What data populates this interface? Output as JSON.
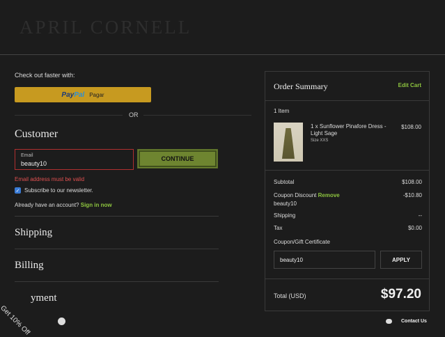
{
  "header": {
    "logo": "APRIL CORNELL"
  },
  "checkout": {
    "fast_label": "Check out faster with:",
    "paypal_pay": "Pay",
    "paypal_pal": "Pal",
    "paypal_action": "Pagar",
    "or_label": "OR"
  },
  "customer": {
    "heading": "Customer",
    "email_label": "Email",
    "email_value": "beauty10",
    "continue_label": "CONTINUE",
    "error_text": "Email address must be valid",
    "subscribe_label": "Subscribe to our newsletter.",
    "account_text": "Already have an account?",
    "signin_label": "Sign in now"
  },
  "sections": {
    "shipping": "Shipping",
    "billing": "Billing",
    "payment": "yment"
  },
  "summary": {
    "title": "Order Summary",
    "edit_label": "Edit Cart",
    "item_count": "1 Item",
    "product_name": "1 x Sunflower Pinafore Dress - Light Sage",
    "product_size": "Size XXS",
    "product_price": "$108.00",
    "subtotal_label": "Subtotal",
    "subtotal_value": "$108.00",
    "coupon_label": "Coupon Discount",
    "coupon_remove": "Remove",
    "coupon_value": "-$10.80",
    "coupon_code": "beauty10",
    "shipping_label": "Shipping",
    "shipping_value": "--",
    "tax_label": "Tax",
    "tax_value": "$0.00",
    "certificate_label": "Coupon/Gift Certificate",
    "coupon_input_value": "beauty10",
    "apply_label": "APPLY",
    "total_label": "Total (USD)",
    "total_value": "$97.20"
  },
  "footer": {
    "promo": "Get 10% Off",
    "contact": "Contact Us"
  },
  "colors": {
    "accent": "#8ec63f",
    "continue": "#6e8530",
    "paypal": "#c79a20",
    "error": "#e05050"
  }
}
